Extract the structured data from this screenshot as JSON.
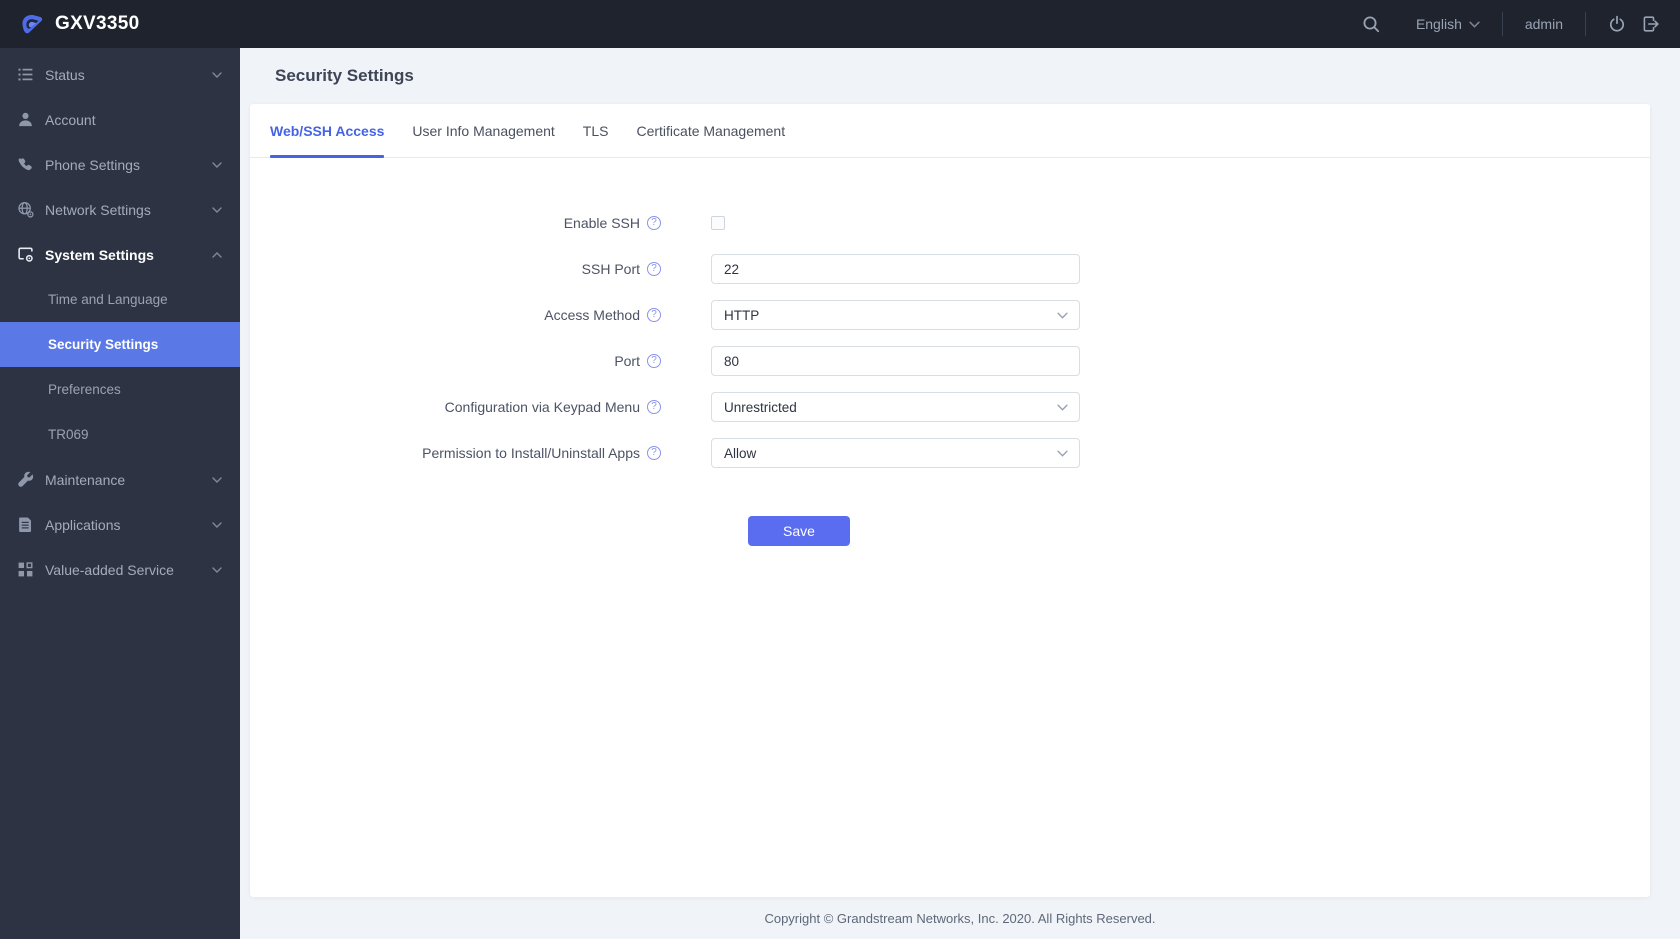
{
  "topbar": {
    "device_title": "GXV3350",
    "language": "English",
    "user": "admin",
    "icons": [
      "grandstream-logo",
      "search-icon",
      "chevron-down-icon",
      "power-icon",
      "logout-icon"
    ]
  },
  "sidebar": {
    "items": [
      {
        "label": "Status",
        "icon": "status-list-icon",
        "expandable": true,
        "active": false
      },
      {
        "label": "Account",
        "icon": "account-person-icon",
        "expandable": false,
        "active": false
      },
      {
        "label": "Phone Settings",
        "icon": "phone-handset-icon",
        "expandable": true,
        "active": false
      },
      {
        "label": "Network Settings",
        "icon": "network-globe-gear-icon",
        "expandable": true,
        "active": false
      },
      {
        "label": "System Settings",
        "icon": "system-monitor-gear-icon",
        "expandable": true,
        "expanded": true,
        "active": true
      },
      {
        "label": "Time and Language",
        "submenu_of": "System Settings",
        "active": false
      },
      {
        "label": "Security Settings",
        "submenu_of": "System Settings",
        "active": true
      },
      {
        "label": "Preferences",
        "submenu_of": "System Settings",
        "active": false
      },
      {
        "label": "TR069",
        "submenu_of": "System Settings",
        "active": false
      },
      {
        "label": "Maintenance",
        "icon": "tools-wrench-icon",
        "expandable": true,
        "active": false
      },
      {
        "label": "Applications",
        "icon": "document-icon",
        "expandable": true,
        "active": false
      },
      {
        "label": "Value-added Service",
        "icon": "grid-squares-icon",
        "expandable": true,
        "active": false
      }
    ]
  },
  "page": {
    "title": "Security Settings"
  },
  "tabs": {
    "items": [
      {
        "label": "Web/SSH Access",
        "active": true
      },
      {
        "label": "User Info Management",
        "active": false
      },
      {
        "label": "TLS",
        "active": false
      },
      {
        "label": "Certificate Management",
        "active": false
      }
    ]
  },
  "form": {
    "rows": [
      {
        "label": "Enable SSH",
        "type": "checkbox",
        "checked": false
      },
      {
        "label": "SSH Port",
        "type": "text",
        "value": "22"
      },
      {
        "label": "Access Method",
        "type": "select",
        "value": "HTTP"
      },
      {
        "label": "Port",
        "type": "text",
        "value": "80"
      },
      {
        "label": "Configuration via Keypad Menu",
        "type": "select",
        "value": "Unrestricted"
      },
      {
        "label": "Permission to Install/Uninstall Apps",
        "type": "select",
        "value": "Allow"
      }
    ],
    "save_label": "Save"
  },
  "footer": {
    "copyright": "Copyright © Grandstream Networks, Inc. 2020. All Rights Reserved."
  },
  "colors": {
    "topbar_bg": "#1e232e",
    "sidebar_bg": "#2d3342",
    "active_menu_bg": "#5b79e6",
    "active_tab": "#4663e8",
    "save_button": "#5a6df0",
    "page_bg": "#f0f4f8"
  }
}
